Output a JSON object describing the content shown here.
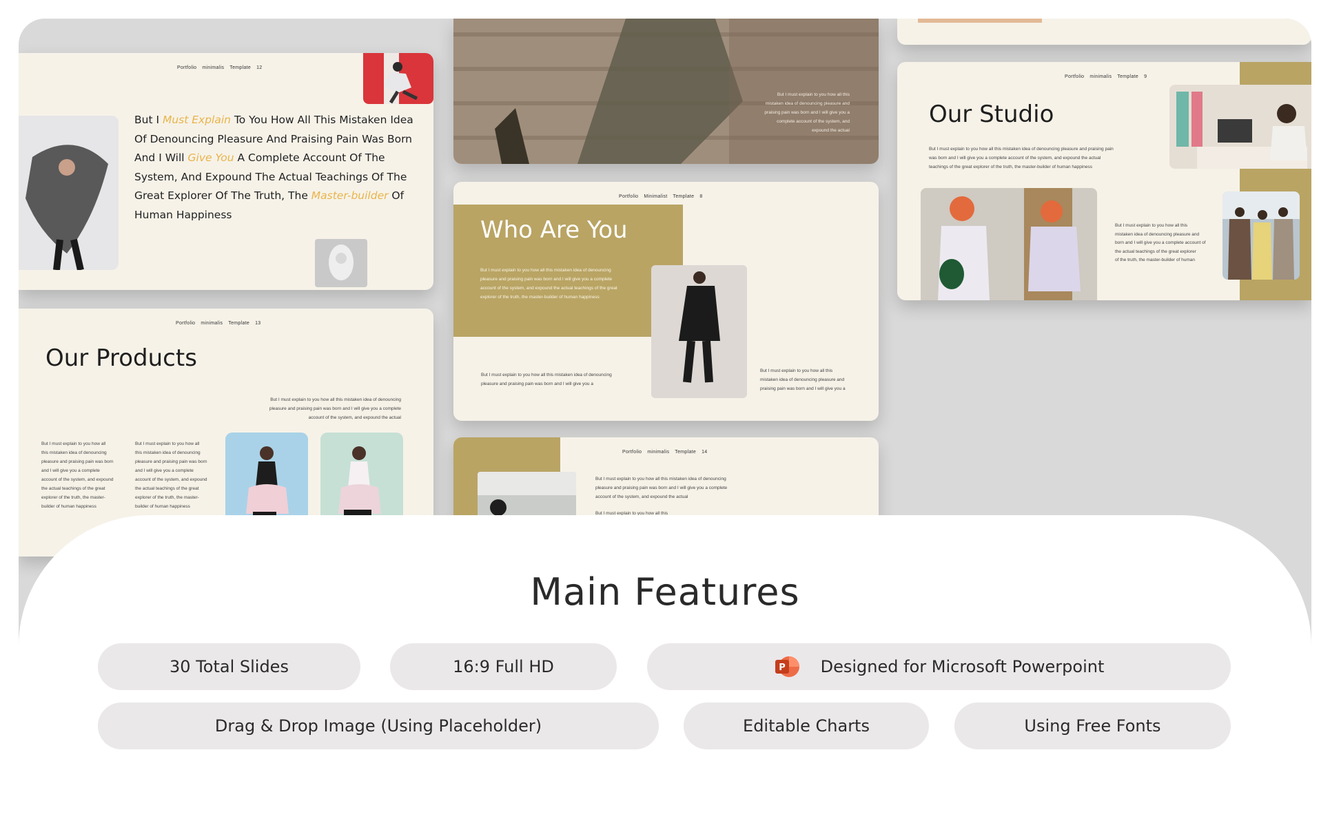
{
  "slides": {
    "quote_slide": {
      "header": [
        "Portfolio",
        "minimalis",
        "Template",
        "12"
      ],
      "quote_parts": [
        {
          "t": "But I ",
          "em": false
        },
        {
          "t": "Must Explain",
          "em": true
        },
        {
          "t": " To You How All This Mistaken Idea Of Denouncing Pleasure And Praising Pain Was Born And I Will ",
          "em": false
        },
        {
          "t": "Give You",
          "em": true
        },
        {
          "t": " A Complete Account Of The System, And Expound The Actual Teachings Of The Great Explorer Of The Truth, The ",
          "em": false
        },
        {
          "t": "Master-builder",
          "em": true
        },
        {
          "t": " Of Human Happiness",
          "em": false
        }
      ]
    },
    "products_slide": {
      "header": [
        "Portfolio",
        "minimalis",
        "Template",
        "13"
      ],
      "title": "Our Products",
      "intro": "But I must explain to you how all this mistaken idea of denouncing pleasure and praising pain was born and I will give you a complete account of the system, and expound the actual",
      "col1": "But I must explain to you how all this mistaken idea of denouncing pleasure and praising pain was born and I will give you a complete account of the system, and expound the actual teachings of the great explorer of the truth, the master-builder of human happiness",
      "col2": "But I must explain to you how all this mistaken idea of denouncing pleasure and praising pain was born and I will give you a complete account of the system, and expound the actual teachings of the great explorer of the truth, the master-builder of human happiness"
    },
    "top_middle_slide": {
      "text": "But I must explain to you how all this mistaken idea of denouncing pleasure and praising pain was born and I will give you a complete account of the system, and expound the actual"
    },
    "who_slide": {
      "header": [
        "Portfolio",
        "Minimalist",
        "Template",
        "8"
      ],
      "title": "Who Are You",
      "gold_text": "But I must explain to you how all this mistaken idea of denouncing pleasure and praising pain was born and I will give you a complete account of the system, and expound the actual teachings of the great explorer of the truth, the master-builder of human happiness",
      "left_text": "But I must explain to you how all this mistaken idea of denouncing pleasure and praising pain was born and I will give you a",
      "right_text": "But I must explain to you how all this mistaken idea of denouncing pleasure and praising pain was born and I will give you a"
    },
    "bottom_middle_slide": {
      "header": [
        "Portfolio",
        "minimalis",
        "Template",
        "14"
      ],
      "text": "But I must explain to you how all this mistaken idea of denouncing pleasure and praising pain was born and I will give you a complete account of the system, and expound the actual",
      "bullet": "But I must explain to you how all this"
    },
    "studio_slide": {
      "header": [
        "Portfolio",
        "minimalis",
        "Template",
        "9"
      ],
      "title": "Our Studio",
      "text": "But I must explain to you how all this mistaken idea of denouncing pleasure and praising pain was born and I will give you a complete account of the system, and expound the actual teachings of the great explorer of the truth, the master-builder of human happiness",
      "bullets": [
        "But I must explain to you how all this",
        "mistaken idea of denouncing pleasure and",
        "born and I will give you a complete account of",
        "the actual teachings of the great explorer",
        "of the truth, the master-builder of human"
      ]
    }
  },
  "features": {
    "title": "Main Features",
    "items": [
      {
        "label": "30 Total Slides"
      },
      {
        "label": "16:9 Full HD"
      },
      {
        "label": "Designed for Microsoft Powerpoint",
        "icon": "powerpoint-icon"
      },
      {
        "label": "Drag & Drop Image (Using Placeholder)"
      },
      {
        "label": "Editable Charts"
      },
      {
        "label": "Using Free Fonts"
      }
    ]
  },
  "colors": {
    "accent_gold": "#b9a464",
    "italic_accent": "#e9b44a",
    "slide_bg": "#f6f2e8",
    "pill_bg": "#ebe8ea"
  }
}
